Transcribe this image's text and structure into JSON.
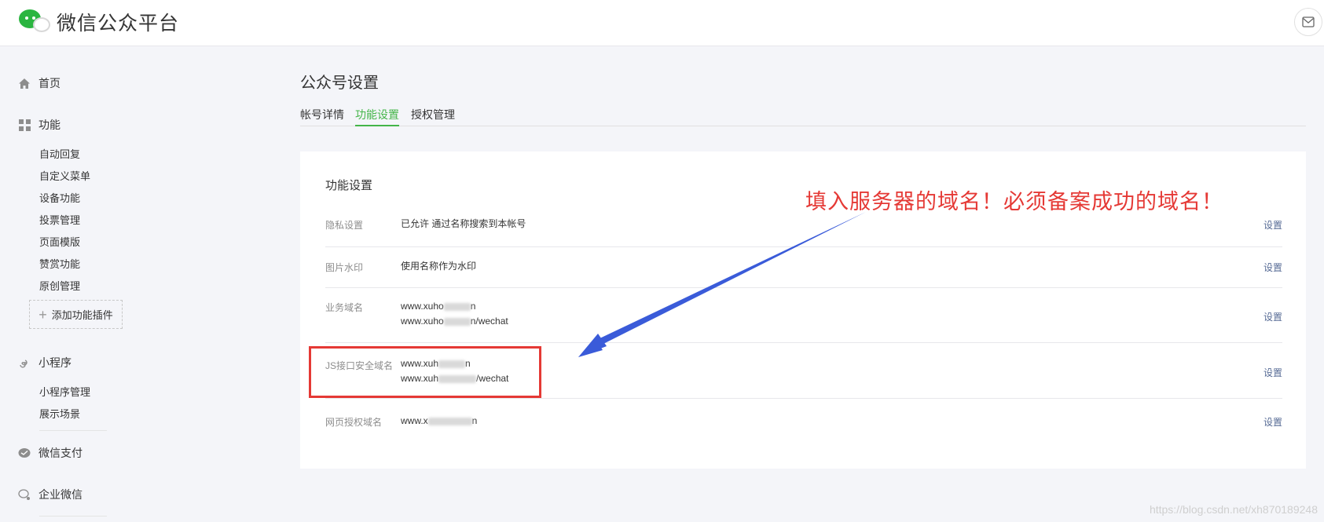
{
  "header": {
    "title": "微信公众平台"
  },
  "sidebar": {
    "home": "首页",
    "function": "功能",
    "function_items": [
      "自动回复",
      "自定义菜单",
      "设备功能",
      "投票管理",
      "页面模版",
      "赞赏功能",
      "原创管理"
    ],
    "add_plugin": "添加功能插件",
    "miniprogram": "小程序",
    "miniprogram_items": [
      "小程序管理",
      "展示场景"
    ],
    "pay": "微信支付",
    "work_wechat": "企业微信"
  },
  "page": {
    "title": "公众号设置",
    "tabs": [
      "帐号详情",
      "功能设置",
      "授权管理"
    ],
    "active_tab": "功能设置"
  },
  "panel": {
    "title": "功能设置",
    "rows": [
      {
        "label": "隐私设置",
        "value_line1": "已允许 通过名称搜索到本帐号",
        "action": "设置"
      },
      {
        "label": "图片水印",
        "value_line1": "使用名称作为水印",
        "action": "设置"
      },
      {
        "label": "业务域名",
        "value_line1_a": "www.xuho",
        "value_line1_b": "n",
        "value_line2_a": "www.xuho",
        "value_line2_b": "n/wechat",
        "action": "设置"
      },
      {
        "label": "JS接口安全域名",
        "value_line1_a": "www.xuh",
        "value_line1_b": "n",
        "value_line2_a": "www.xuh",
        "value_line2_b": "/wechat",
        "action": "设置"
      },
      {
        "label": "网页授权域名",
        "value_line1_a": "www.x",
        "value_line1_b": "n",
        "action": "设置"
      }
    ]
  },
  "annotation": {
    "text": "填入服务器的域名！必须备案成功的域名！",
    "color": "#e53935"
  },
  "watermark": "https://blog.csdn.net/xh870189248",
  "colors": {
    "accent_green": "#44b549",
    "link_blue": "#576b95",
    "annotation_red": "#e53935",
    "arrow_blue": "#3a5bd9"
  }
}
